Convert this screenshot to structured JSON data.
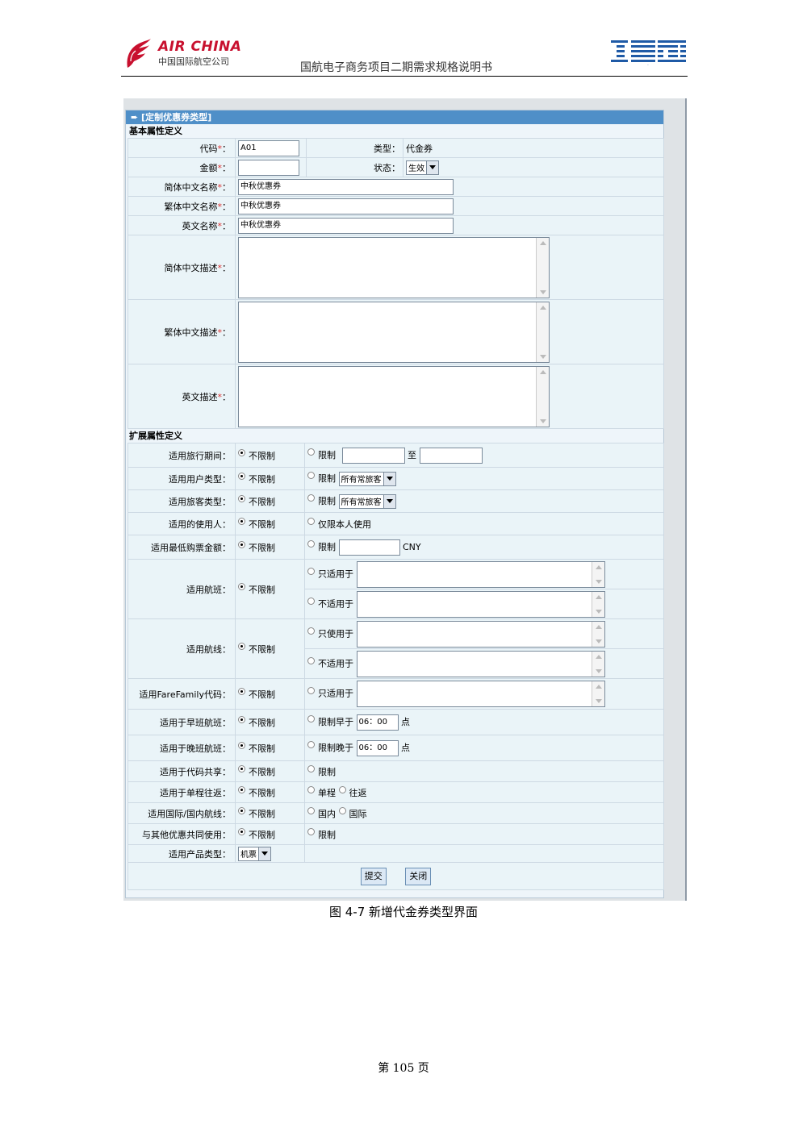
{
  "header": {
    "airline_en": "AIR CHINA",
    "airline_cn": "中国国际航空公司",
    "doc_title": "国航电子商务项目二期需求规格说明书",
    "vendor_logo": "IBM",
    "brand_red": "#c8102e",
    "ibm_blue": "#1f5aa6"
  },
  "form": {
    "panel_title": "[定制优惠券类型]",
    "basic_section": "基本属性定义",
    "ext_section": "扩展属性定义",
    "star": "*",
    "basic": {
      "code_label": "代码",
      "code_value": "A01",
      "type_label": "类型：",
      "type_value": "代金券",
      "amount_label": "金额",
      "amount_value": "",
      "status_label": "状态：",
      "status_value": "生效",
      "sc_name_label": "简体中文名称",
      "sc_name_value": "中秋优惠券",
      "tc_name_label": "繁体中文名称",
      "tc_name_value": "中秋优惠券",
      "en_name_label": "英文名称",
      "en_name_value": "中秋优惠券",
      "sc_desc_label": "简体中文描述",
      "tc_desc_label": "繁体中文描述",
      "en_desc_label": "英文描述"
    },
    "ext": {
      "unlimited": "不限制",
      "limit": "限制",
      "travel_period_label": "适用旅行期间：",
      "to": "至",
      "user_type_label": "适用用户类型：",
      "user_type_option": "所有常旅客",
      "pax_type_label": "适用旅客类型：",
      "pax_type_option": "所有常旅客",
      "user_label": "适用的使用人：",
      "self_only": "仅限本人使用",
      "min_amount_label": "适用最低购票金额：",
      "currency": "CNY",
      "flight_label": "适用航班：",
      "only_for": "只适用于",
      "not_for": "不适用于",
      "route_label": "适用航线：",
      "only_use": "只使用于",
      "farefamily_label": "适用FareFamily代码：",
      "morning_label": "适用于早班航班：",
      "earlier_than": "限制早于",
      "morning_time": "06：00",
      "point": "点",
      "evening_label": "适用于晚班航班：",
      "later_than": "限制晚于",
      "evening_time": "06：00",
      "codeshare_label": "适用于代码共享：",
      "trip_label": "适用于单程往返：",
      "oneway": "单程",
      "roundtrip": "往返",
      "intl_label": "适用国际/国内航线：",
      "domestic": "国内",
      "international": "国际",
      "combine_label": "与其他优惠共同使用：",
      "product_label": "适用产品类型：",
      "product_value": "机票"
    },
    "submit": "提交",
    "close": "关闭"
  },
  "caption": "图 4-7 新增代金券类型界面",
  "page_number": "第 105 页"
}
